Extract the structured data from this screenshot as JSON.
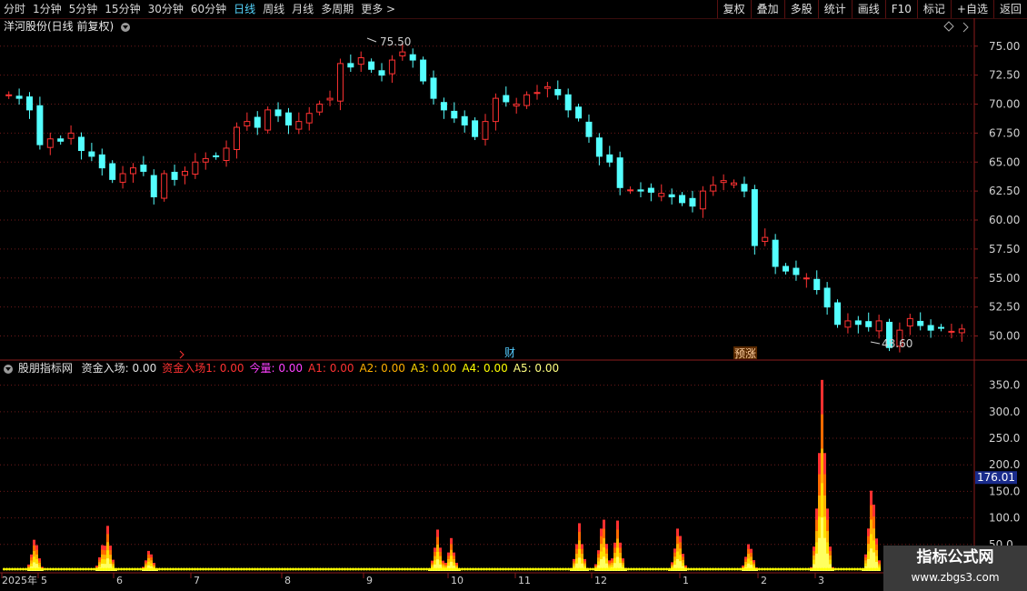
{
  "toolbar": {
    "periods": [
      "分时",
      "1分钟",
      "5分钟",
      "15分钟",
      "30分钟",
      "60分钟",
      "日线",
      "周线",
      "月线",
      "多周期",
      "更多 >"
    ],
    "active": "日线",
    "right_buttons": [
      "复权",
      "叠加",
      "多股",
      "统计",
      "画线",
      "F10",
      "标记",
      "+自选",
      "返回"
    ]
  },
  "main": {
    "stock_title": "洋河股份(日线 前复权)",
    "y_ticks": [
      "75.00",
      "72.50",
      "70.00",
      "67.50",
      "65.00",
      "62.50",
      "60.00",
      "57.50",
      "55.00",
      "52.50",
      "50.00"
    ],
    "high_label": "75.50",
    "low_label": "48.60",
    "event_labels": [
      "财",
      "预涨"
    ],
    "colors": {
      "up": "#ff3232",
      "down": "#54ffff",
      "grid": "#6e1a1a",
      "axis": "#8b1c1c"
    }
  },
  "indicator": {
    "name": "股朋指标网",
    "fields": [
      {
        "label": "资金入场:",
        "value": "0.00",
        "color": "#e0e0e0"
      },
      {
        "label": "资金入场1:",
        "value": "0.00",
        "color": "#ff3232"
      },
      {
        "label": "今量:",
        "value": "0.00",
        "color": "#ff40ff"
      },
      {
        "label": "A1:",
        "value": "0.00",
        "color": "#ff3232"
      },
      {
        "label": "A2:",
        "value": "0.00",
        "color": "#ffb000"
      },
      {
        "label": "A3:",
        "value": "0.00",
        "color": "#ffd700"
      },
      {
        "label": "A4:",
        "value": "0.00",
        "color": "#ffff00"
      },
      {
        "label": "A5:",
        "value": "0.00",
        "color": "#ffff80"
      }
    ],
    "y_ticks": [
      "350.0",
      "300.0",
      "250.0",
      "200.0",
      "150.0",
      "100.0",
      "50.0"
    ],
    "current_value": "176.01"
  },
  "time_axis": [
    "2025年",
    "5",
    "6",
    "7",
    "8",
    "9",
    "10",
    "11",
    "12",
    "1",
    "2",
    "3"
  ],
  "watermark": {
    "title": "指标公式网",
    "url": "www.zbgs3.com"
  },
  "chart_data": [
    {
      "type": "candlestick",
      "title": "洋河股份(日线 前复权)",
      "ylim": [
        48.0,
        76.0
      ],
      "x": [
        "2025-04",
        "2025-05",
        "2025-06",
        "2025-07",
        "2025-08",
        "2025-09",
        "2025-10",
        "2025-11",
        "2025-12",
        "2026-01",
        "2026-02",
        "2026-03"
      ],
      "close_path": [
        70.8,
        70.5,
        69.5,
        66.5,
        67.0,
        66.8,
        67.5,
        66.0,
        65.5,
        64.5,
        63.5,
        64.0,
        64.5,
        64.2,
        62.0,
        64.0,
        63.5,
        64.2,
        65.0,
        65.3,
        65.5,
        66.2,
        68.0,
        68.5,
        68.0,
        69.5,
        69.0,
        68.2,
        68.5,
        69.2,
        70.0,
        70.5,
        73.5,
        73.2,
        74.0,
        73.0,
        72.5,
        73.8,
        74.5,
        73.8,
        72.0,
        70.5,
        69.5,
        68.8,
        68.2,
        67.2,
        68.5,
        70.5,
        70.2,
        70.0,
        70.8,
        71.0,
        71.5,
        70.8,
        69.5,
        68.8,
        67.2,
        65.5,
        65.0,
        62.8,
        62.6,
        62.5,
        62.4,
        62.3,
        62.0,
        61.5,
        61.2,
        62.5,
        63.0,
        63.4,
        63.2,
        62.5,
        57.8,
        58.5,
        56.0,
        55.6,
        55.3,
        55.0,
        54.0,
        52.5,
        51.0,
        51.3,
        51.0,
        50.8,
        51.3,
        49.0,
        50.5,
        51.5,
        50.9,
        50.5,
        50.7,
        50.4,
        50.6
      ],
      "high": 75.5,
      "low": 48.6
    },
    {
      "type": "bar",
      "title": "股朋指标网",
      "ylim": [
        0,
        370
      ],
      "peaks": [
        {
          "x": "2025-05",
          "value": 70
        },
        {
          "x": "2025-06",
          "value": 85
        },
        {
          "x": "2025-06",
          "value": 45
        },
        {
          "x": "2025-10",
          "value": 80
        },
        {
          "x": "2025-12",
          "value": 115
        },
        {
          "x": "2026-01",
          "value": 95
        },
        {
          "x": "2026-02",
          "value": 60
        },
        {
          "x": "2026-03",
          "value": 360
        },
        {
          "x": "2026-03",
          "value": 180
        }
      ],
      "current": 176.01
    }
  ]
}
